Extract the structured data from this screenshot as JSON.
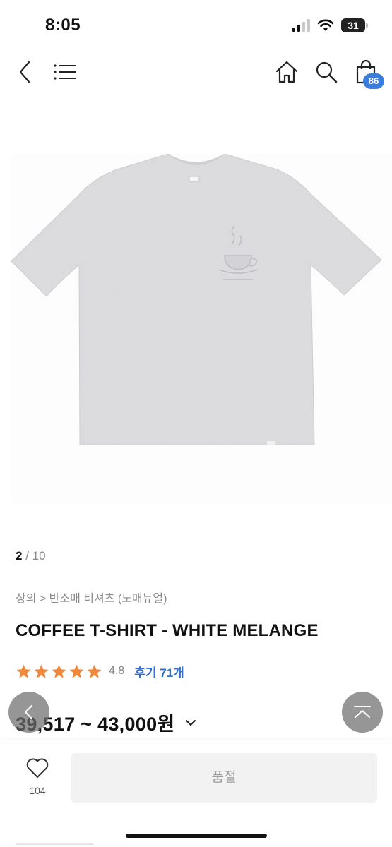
{
  "status_bar": {
    "time": "8:05",
    "battery": "31"
  },
  "nav": {
    "back_icon": "chevron-left-icon",
    "menu_icon": "hamburger-menu-icon",
    "home_icon": "home-icon",
    "search_icon": "search-icon",
    "cart_icon": "shopping-bag-icon",
    "cart_count": "86"
  },
  "product": {
    "image_index": "2",
    "image_total": "/ 10",
    "breadcrumb": "상의 > 반소매 티셔츠 (노매뉴얼)",
    "title": "COFFEE T-SHIRT - WHITE MELANGE",
    "rating": "4.8",
    "stars": 5,
    "reviews_label": "후기 71개",
    "price_range": "39,517 ~ 43,000원",
    "shirt_color": "#dddde0"
  },
  "bottom_bar": {
    "like_count": "104",
    "soldout_label": "품절"
  },
  "colors": {
    "accent_blue": "#2f6fd6",
    "star_orange": "#f0883b",
    "badge_blue": "#3b7ddd"
  }
}
